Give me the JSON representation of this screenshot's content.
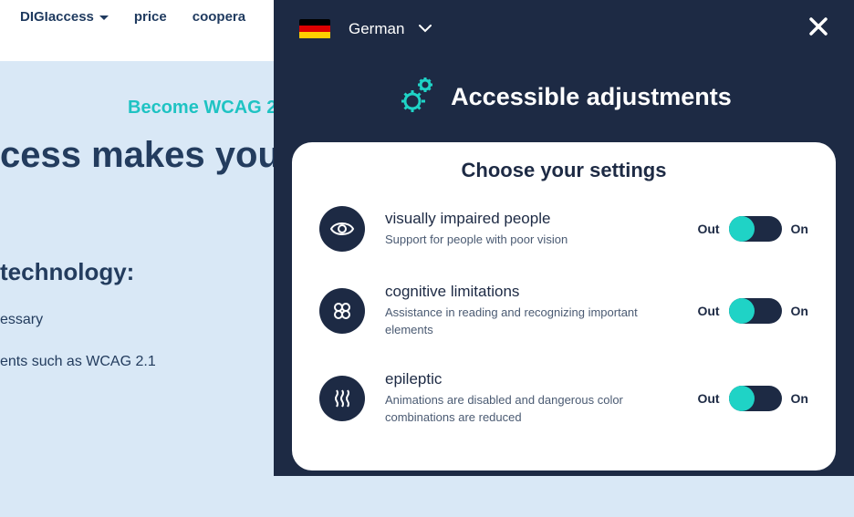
{
  "nav": {
    "items": [
      "DIGIaccess",
      "price",
      "coopera"
    ]
  },
  "hero": {
    "sub": "Become WCAG 2",
    "title": "cess makes you",
    "tech_title": "technology:",
    "line1": "essary",
    "line2": "ents such as WCAG 2.1"
  },
  "panel": {
    "language": "German",
    "title": "Accessible adjustments",
    "card_title": "Choose your settings",
    "out_label": "Out",
    "on_label": "On",
    "settings": [
      {
        "name": "visually impaired people",
        "desc": "Support for people with poor vision"
      },
      {
        "name": "cognitive limitations",
        "desc": "Assistance in reading and recognizing important elements"
      },
      {
        "name": "epileptic",
        "desc": "Animations are disabled and dangerous color combinations are reduced"
      }
    ]
  },
  "colors": {
    "accent": "#1fd3c6",
    "panel_bg": "#1d2a44"
  }
}
